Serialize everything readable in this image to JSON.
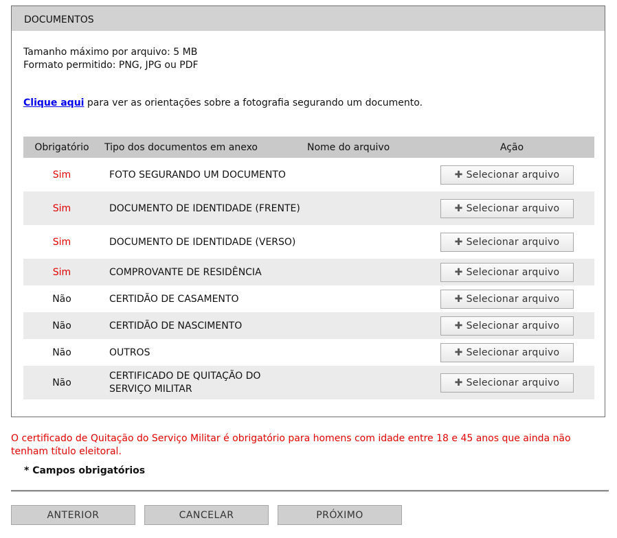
{
  "panel": {
    "title": "DOCUMENTOS",
    "max_size": "Tamanho máximo por arquivo: 5 MB",
    "formats": "Formato permitido: PNG, JPG ou PDF",
    "orient_link": "Clique aqui",
    "orient_text": " para ver as orientações sobre a fotografia segurando um documento."
  },
  "table": {
    "headers": [
      "Obrigatório",
      "Tipo dos documentos em anexo",
      "Nome do arquivo",
      "Ação"
    ],
    "rows": [
      {
        "required": "Sim",
        "type": "FOTO SEGURANDO UM DOCUMENTO",
        "file": "",
        "action": "Selecionar arquivo"
      },
      {
        "required": "Sim",
        "type": "DOCUMENTO DE IDENTIDADE (FRENTE)",
        "file": "",
        "action": "Selecionar arquivo"
      },
      {
        "required": "Sim",
        "type": "DOCUMENTO DE IDENTIDADE (VERSO)",
        "file": "",
        "action": "Selecionar arquivo"
      },
      {
        "required": "Sim",
        "type": "COMPROVANTE DE RESIDÊNCIA",
        "file": "",
        "action": "Selecionar arquivo"
      },
      {
        "required": "Não",
        "type": "CERTIDÃO DE CASAMENTO",
        "file": "",
        "action": "Selecionar arquivo"
      },
      {
        "required": "Não",
        "type": "CERTIDÃO DE NASCIMENTO",
        "file": "",
        "action": "Selecionar arquivo"
      },
      {
        "required": "Não",
        "type": "OUTROS",
        "file": "",
        "action": "Selecionar arquivo"
      },
      {
        "required": "Não",
        "type": "CERTIFICADO DE QUITAÇÃO DO SERVIÇO MILITAR",
        "file": "",
        "action": "Selecionar arquivo"
      }
    ]
  },
  "icons": {
    "select": "plus-icon"
  },
  "colors": {
    "required": "#e00000",
    "link": "#0000ee",
    "header_bg": "#d2d2d2"
  },
  "warning": "O certificado de Quitação do Serviço Militar é obrigatório para homens com idade entre 18 e 45 anos que ainda não tenham título eleitoral.",
  "required_note": "* Campos obrigatórios",
  "nav": {
    "previous": "ANTERIOR",
    "cancel": "CANCELAR",
    "next": "PRÓXIMO"
  }
}
